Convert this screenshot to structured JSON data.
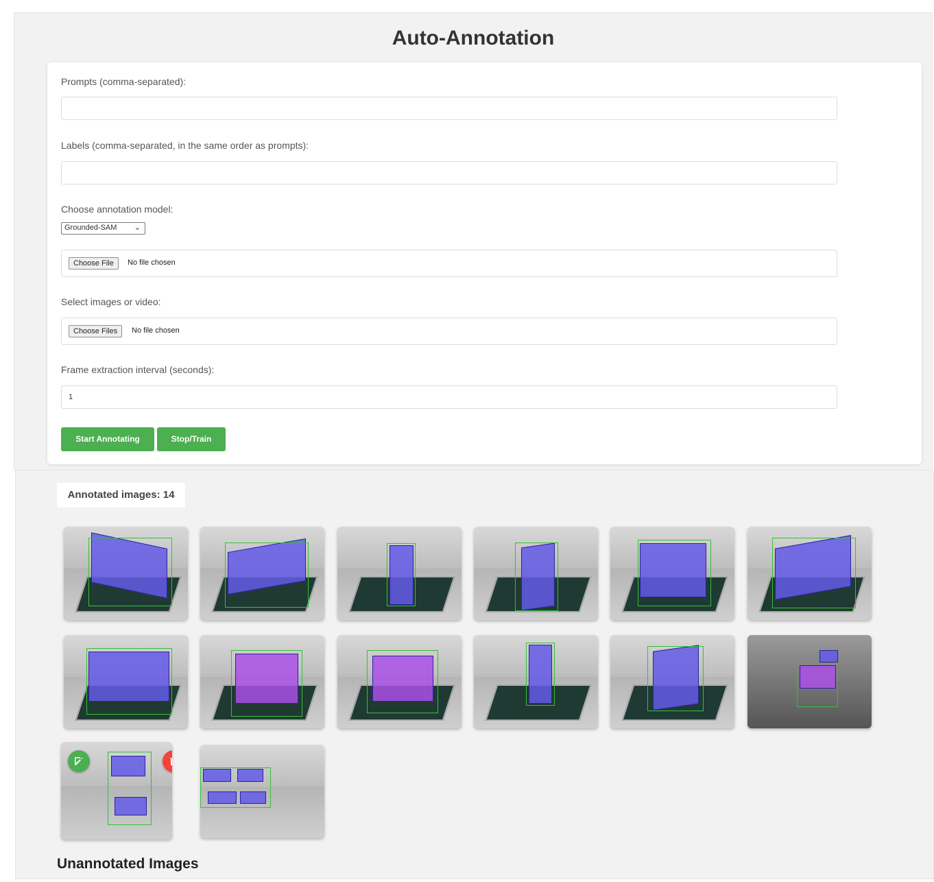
{
  "title": "Auto-Annotation",
  "form": {
    "prompts_label": "Prompts (comma-separated):",
    "prompts_value": "",
    "labels_label": "Labels (comma-separated, in the same order as prompts):",
    "labels_value": "",
    "model_label": "Choose annotation model:",
    "model_selected": "Grounded-SAM",
    "model_file_button": "Choose File",
    "model_file_status": "No file chosen",
    "media_label": "Select images or video:",
    "media_file_button": "Choose Files",
    "media_file_status": "No file chosen",
    "interval_label": "Frame extraction interval (seconds):",
    "interval_value": "1",
    "start_button": "Start Annotating",
    "stop_button": "Stop/Train"
  },
  "annotated": {
    "count_label": "Annotated images: 14",
    "icons": {
      "edit": "edit-icon",
      "delete": "trash-icon"
    },
    "colors": {
      "edit": "#4caf50",
      "delete": "#f44336",
      "mask": "#6a5ae6",
      "bbox": "#35c035"
    }
  },
  "unannotated": {
    "heading": "Unannotated Images"
  },
  "colors": {
    "accent": "#4caf50",
    "background": "#f2f2f2"
  }
}
